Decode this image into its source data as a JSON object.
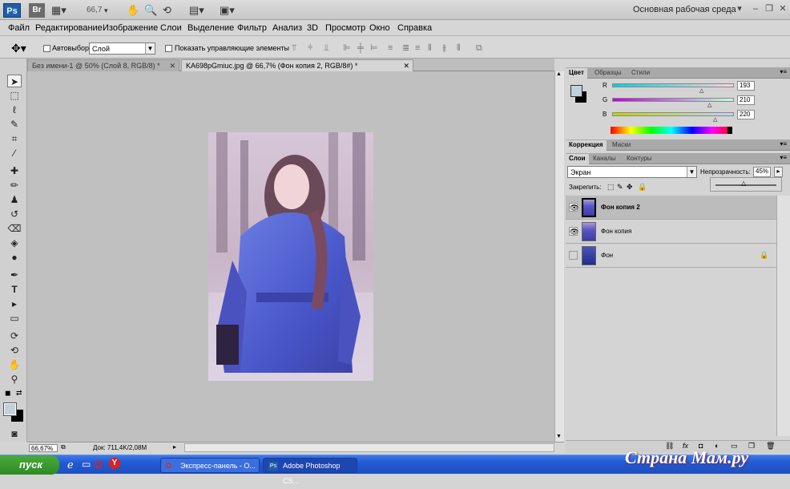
{
  "appbar": {
    "logo": "Ps",
    "bridge": "Br",
    "zoom": "66,7",
    "workspace": "Основная рабочая среда"
  },
  "menu": [
    "Файл",
    "Редактирование",
    "Изображение",
    "Слои",
    "Выделение",
    "Фильтр",
    "Анализ",
    "3D",
    "Просмотр",
    "Окно",
    "Справка"
  ],
  "options": {
    "autoselect_label": "Автовыбор:",
    "autoselect_value": "Слой",
    "show_controls_label": "Показать управляющие элементы"
  },
  "tabs": [
    {
      "label": "Без имени-1 @ 50% (Слой 8, RGB/8) *"
    },
    {
      "label": "KA698pGmiuc.jpg @ 66,7% (Фон копия 2, RGB/8#) *"
    }
  ],
  "status": {
    "zoom": "66,67%",
    "doc": "Док: 711,4K/2,08M"
  },
  "color_panel": {
    "tabs": [
      "Цвет",
      "Образцы",
      "Стили"
    ],
    "r_label": "R",
    "g_label": "G",
    "b_label": "B",
    "r": "193",
    "g": "210",
    "b": "220",
    "swatch": "#c1d2dc"
  },
  "adjust_panel": {
    "tabs": [
      "Коррекция",
      "Маски"
    ]
  },
  "layers_panel": {
    "tabs": [
      "Слои",
      "Каналы",
      "Контуры"
    ],
    "blend_mode": "Экран",
    "opacity_label": "Непрозрачность:",
    "opacity": "45%",
    "lock_label": "Закрепить:",
    "layers": [
      {
        "name": "Фон копия 2",
        "visible": true,
        "selected": true
      },
      {
        "name": "Фон копия",
        "visible": true,
        "selected": false
      },
      {
        "name": "Фон",
        "visible": false,
        "selected": false
      }
    ]
  },
  "taskbar": {
    "start": "пуск",
    "items": [
      "Экспресс-панель - О...",
      "Adobe Photoshop CS..."
    ],
    "watermark": "Страна Мам.ру"
  }
}
